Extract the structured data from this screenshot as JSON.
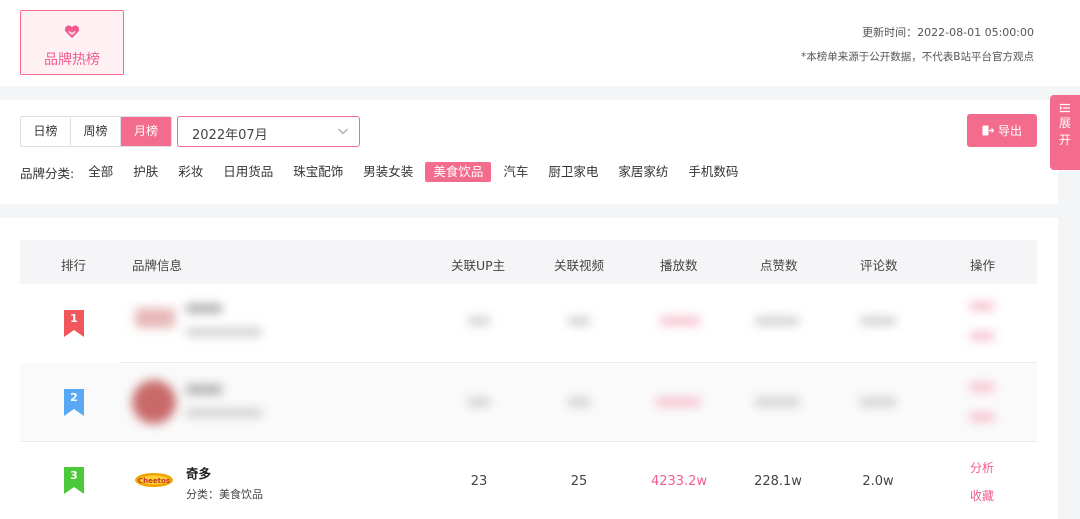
{
  "header": {
    "badge_title": "品牌热榜",
    "update_time": "更新时间：2022-08-01 05:00:00",
    "disclaimer": "*本榜单来源于公开数据，不代表B站平台官方观点"
  },
  "filters": {
    "period_tabs": [
      "日榜",
      "周榜",
      "月榜"
    ],
    "active_period": "月榜",
    "month_value": "2022年07月",
    "export_label": "导出",
    "category_label": "品牌分类:",
    "categories": [
      "全部",
      "护肤",
      "彩妆",
      "日用货品",
      "珠宝配饰",
      "男装女装",
      "美食饮品",
      "汽车",
      "厨卫家电",
      "家居家纺",
      "手机数码"
    ],
    "active_category": "美食饮品"
  },
  "side_tab": {
    "label": "展开"
  },
  "table": {
    "headers": [
      "排行",
      "品牌信息",
      "关联UP主",
      "关联视频",
      "播放数",
      "点赞数",
      "评论数",
      "操作"
    ],
    "rows": [
      {
        "rank": "1",
        "name": "",
        "category": "",
        "up": "",
        "videos": "",
        "plays": "",
        "likes": "",
        "comments": "",
        "ops": [
          "",
          ""
        ],
        "obscured": true
      },
      {
        "rank": "2",
        "name": "",
        "category": "",
        "up": "",
        "videos": "",
        "plays": "",
        "likes": "",
        "comments": "",
        "ops": [
          "",
          ""
        ],
        "obscured": true
      },
      {
        "rank": "3",
        "name": "奇多",
        "category": "分类：美食饮品",
        "up": "23",
        "videos": "25",
        "plays": "4233.2w",
        "likes": "228.1w",
        "comments": "2.0w",
        "ops": [
          "分析",
          "收藏"
        ],
        "obscured": false
      }
    ]
  },
  "colors": {
    "accent": "#f36b8d",
    "rank1": "#f0565c",
    "rank2": "#58a8f5",
    "rank3": "#4cc93a"
  }
}
